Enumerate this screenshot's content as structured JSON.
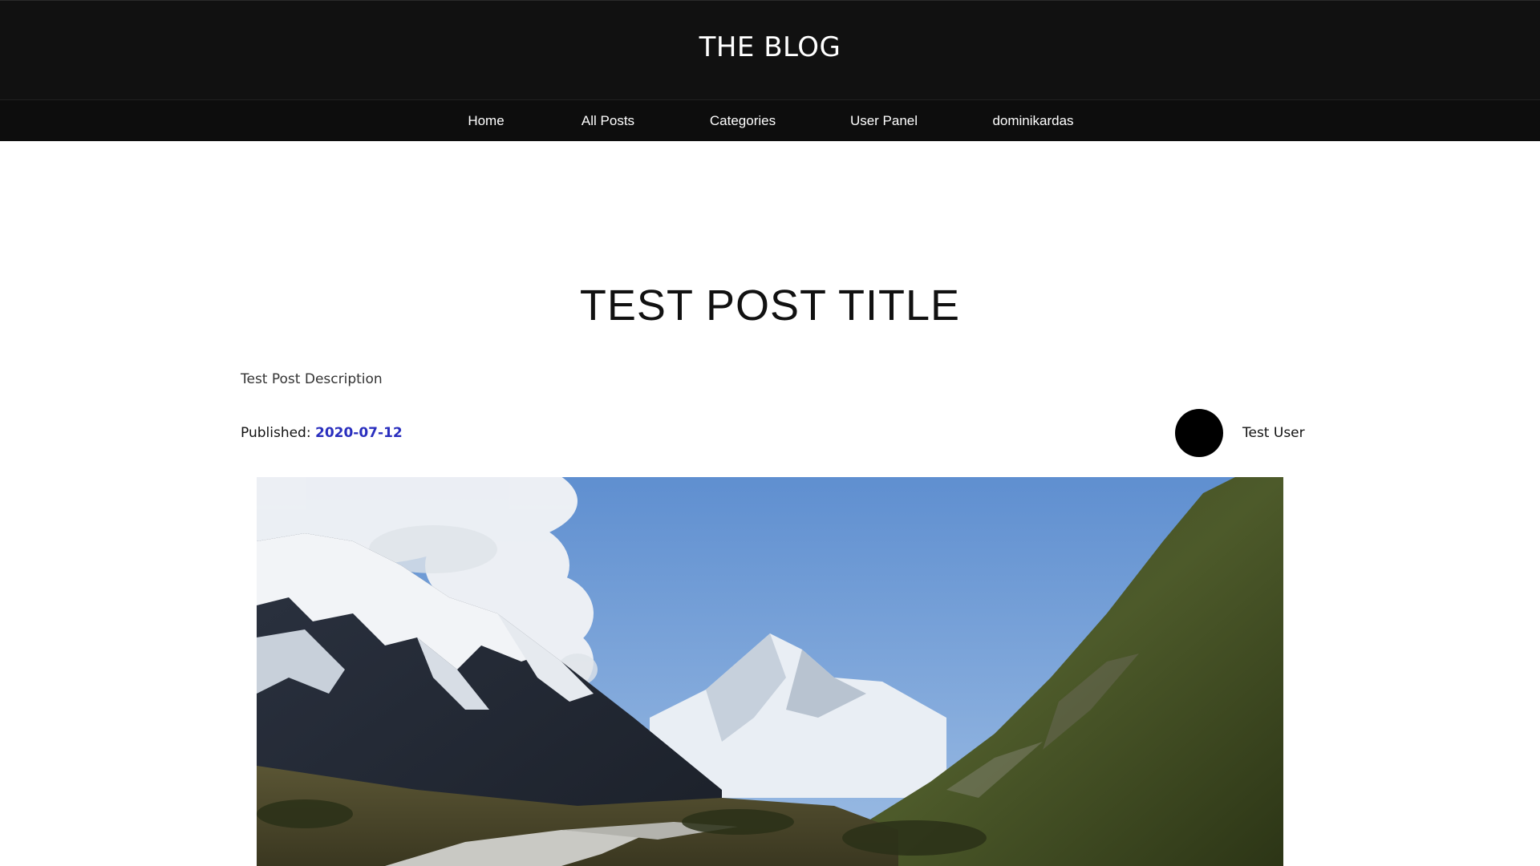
{
  "header": {
    "brand": "THE BLOG"
  },
  "nav": {
    "items": [
      {
        "label": "Home"
      },
      {
        "label": "All Posts"
      },
      {
        "label": "Categories"
      },
      {
        "label": "User Panel"
      },
      {
        "label": "dominikardas"
      }
    ]
  },
  "post": {
    "title": "TEST POST TITLE",
    "description": "Test Post Description",
    "published_label": "Published:",
    "published_date": "2020-07-12",
    "author": "Test User",
    "image_subject": "snowy-mountain-valley-photo"
  },
  "colors": {
    "header_bg": "#111111",
    "link": "#2a2fbe",
    "avatar": "#000000"
  }
}
